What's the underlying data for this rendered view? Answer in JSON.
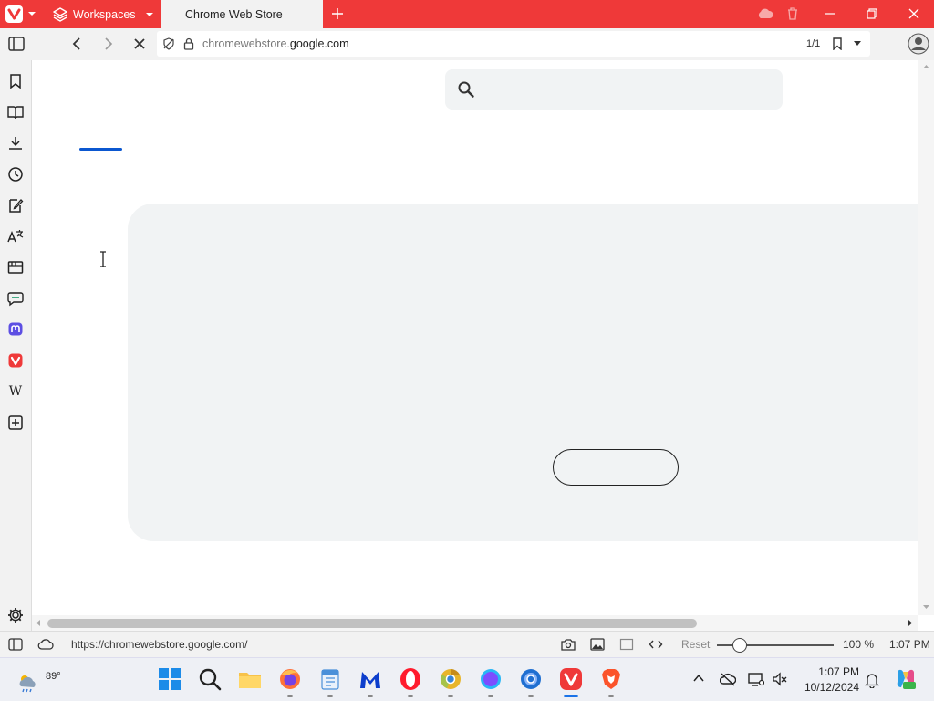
{
  "browser": {
    "workspaces_label": "Workspaces",
    "tab_title": "Chrome Web Store",
    "accent_color": "#ef3939"
  },
  "address": {
    "url_prefix": "chromewebstore.",
    "url_domain": "google.com",
    "page_count": "1/1"
  },
  "sidepanel": {
    "items": [
      "bookmark-icon",
      "reading-list-icon",
      "downloads-icon",
      "history-icon",
      "notes-icon",
      "translate-icon",
      "window-panel-icon",
      "mail-icon",
      "mastodon-icon",
      "vivaldi-icon",
      "wikipedia-icon",
      "add-panel-icon"
    ],
    "wikipedia_glyph": "W"
  },
  "statusbar": {
    "link_url": "https://chromewebstore.google.com/",
    "reset_label": "Reset",
    "zoom": "100 %",
    "zoom_percent": 100,
    "time": "1:07 PM"
  },
  "taskbar": {
    "temperature": "89°",
    "apps": [
      "windows-start-icon",
      "search-icon",
      "file-explorer-icon",
      "firefox-icon",
      "notepad-icon",
      "malwarebytes-icon",
      "opera-icon",
      "chrome-canary-icon",
      "circle-app-icon",
      "chrome-icon",
      "vivaldi-icon",
      "brave-icon"
    ],
    "time": "1:07 PM",
    "date": "10/12/2024"
  }
}
